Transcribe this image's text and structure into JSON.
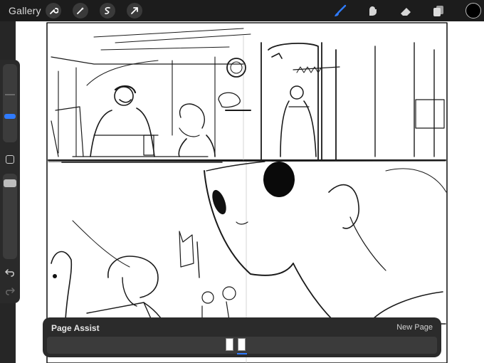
{
  "toolbar": {
    "gallery_label": "Gallery",
    "left_tools": [
      "wrench-icon",
      "magic-wand-icon",
      "selection-icon",
      "transform-icon"
    ],
    "right_tools": [
      "brush-icon",
      "smudge-icon",
      "eraser-icon",
      "layers-icon"
    ],
    "active_tool": "brush-icon",
    "accent_color": "#2f7bff",
    "current_color": "#000000"
  },
  "sidebar": {
    "controls": [
      "brush-size-slider",
      "modify-button",
      "opacity-slider",
      "undo-icon",
      "redo-icon"
    ]
  },
  "page_assist": {
    "title": "Page Assist",
    "new_page_label": "New Page",
    "page_count": 2,
    "active_page": 2
  }
}
